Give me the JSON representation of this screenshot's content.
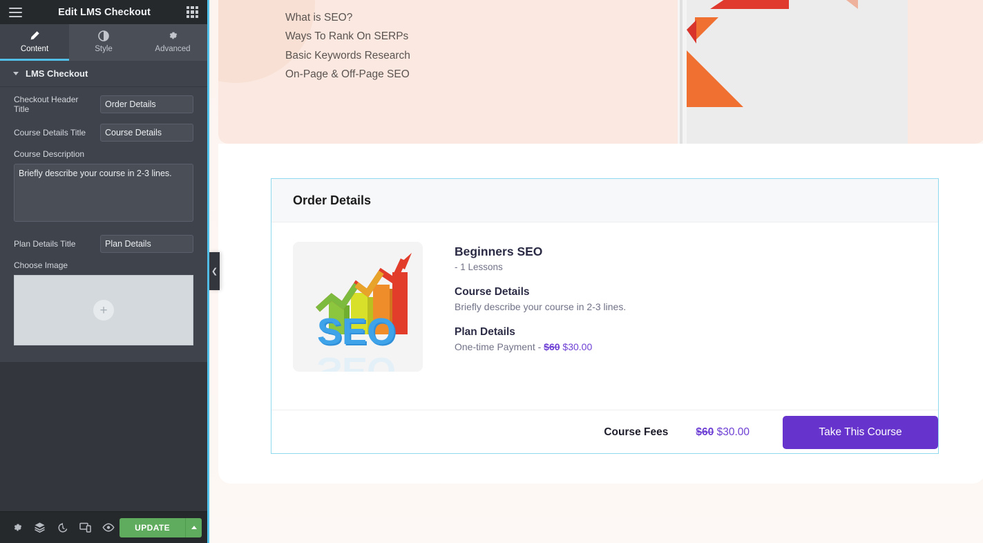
{
  "panel": {
    "header": {
      "menu_icon": "hamburger-icon",
      "title": "Edit LMS Checkout",
      "apps_icon": "grid-apps-icon"
    },
    "tabs": [
      {
        "label": "Content",
        "icon": "pencil-icon",
        "active": true
      },
      {
        "label": "Style",
        "icon": "half-circle-icon",
        "active": false
      },
      {
        "label": "Advanced",
        "icon": "gear-icon",
        "active": false
      }
    ],
    "section": {
      "label": "LMS Checkout",
      "caret": "caret-down-icon"
    },
    "controls": {
      "checkout_header_title": {
        "label": "Checkout Header Title",
        "value": "Order Details",
        "placeholder": ""
      },
      "course_details_title": {
        "label": "Course Details Title",
        "value": "Course Details",
        "placeholder": ""
      },
      "course_description": {
        "label": "Course Description",
        "value": "Briefly describe your course in 2-3 lines.",
        "placeholder": ""
      },
      "plan_details_title": {
        "label": "Plan Details Title",
        "value": "Plan Details",
        "placeholder": ""
      },
      "choose_image": {
        "label": "Choose Image",
        "plus_icon": "plus-icon"
      }
    },
    "footer": {
      "icons": [
        "settings-gear-icon",
        "navigator-layers-icon",
        "history-revisions-icon",
        "responsive-mode-icon",
        "preview-eye-icon"
      ],
      "update_label": "UPDATE",
      "update_caret_icon": "caret-up-icon",
      "update_color": "#60ac5e"
    },
    "collapse_handle": {
      "icon": "chevron-left-icon"
    }
  },
  "canvas": {
    "hero": {
      "background": "#fbe9e1",
      "list": [
        "What is SEO?",
        "Ways To Rank On SERPs",
        "Basic Keywords Research",
        "On-Page & Off-Page SEO"
      ],
      "art_alt": "geometric-triangles-graphic"
    },
    "widget": {
      "selected_outline": "#8fd8ee",
      "header_title": "Order Details",
      "thumbnail_alt": "seo-3d-bar-chart-image",
      "course_title": "Beginners SEO",
      "lessons": "- 1 Lessons",
      "course_details_heading": "Course Details",
      "course_details_text": "Briefly describe your course in 2-3 lines.",
      "plan_details_heading": "Plan Details",
      "plan_prefix": "One-time Payment - ",
      "plan_old_price": "$60",
      "plan_new_price": "$30.00",
      "fees_label": "Course Fees",
      "fees_old_price": "$60",
      "fees_new_price": "$30.00",
      "cta_label": "Take This Course",
      "cta_color": "#6633cc",
      "price_color": "#6d3fd4"
    }
  }
}
